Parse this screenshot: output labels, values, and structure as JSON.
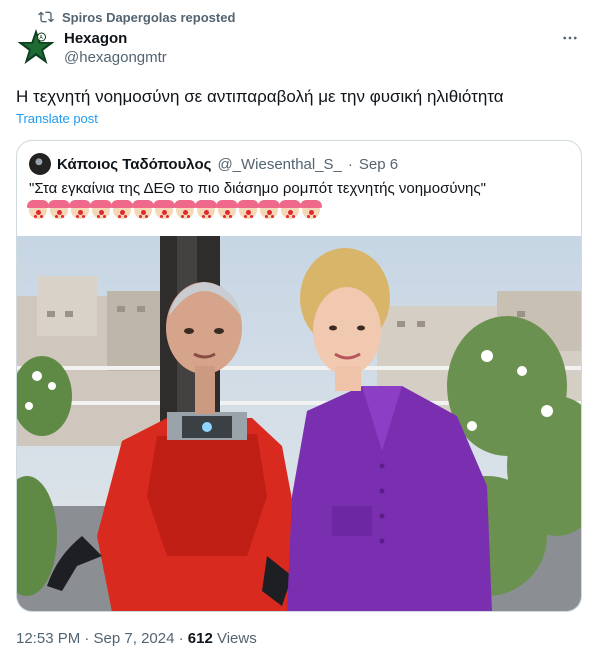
{
  "repost": {
    "text": "Spiros Dapergolas reposted",
    "icon": "repost-icon"
  },
  "author": {
    "name": "Hexagon",
    "handle": "@hexagongmtr",
    "avatar_icon": "green-star-avatar"
  },
  "more_icon": "more-dots-icon",
  "post": {
    "text": "Η τεχνητή νοημοσύνη σε αντιπαραβολή με την φυσική ηλιθιότητα",
    "translate_label": "Translate post"
  },
  "quote": {
    "author_name": "Κάποιος Ταδόπουλος",
    "handle": "@_Wiesenthal_S_",
    "dot": "·",
    "date": "Sep 6",
    "text": "\"Στα εγκαίνια της ΔΕΘ το πιο διάσημο ρομπότ τεχνητής νοημοσύνης\"",
    "emoji": {
      "name": "clown-face",
      "count": 14
    },
    "photo": {
      "subject": "humanoid-robot-and-woman-photo"
    }
  },
  "footer": {
    "time": "12:53 PM · Sep 7, 2024 · ",
    "views_count": "612",
    "views_label": " Views"
  },
  "colors": {
    "accent": "#1d9bf0",
    "secondary_text": "#536471",
    "border": "#cfd9de"
  }
}
